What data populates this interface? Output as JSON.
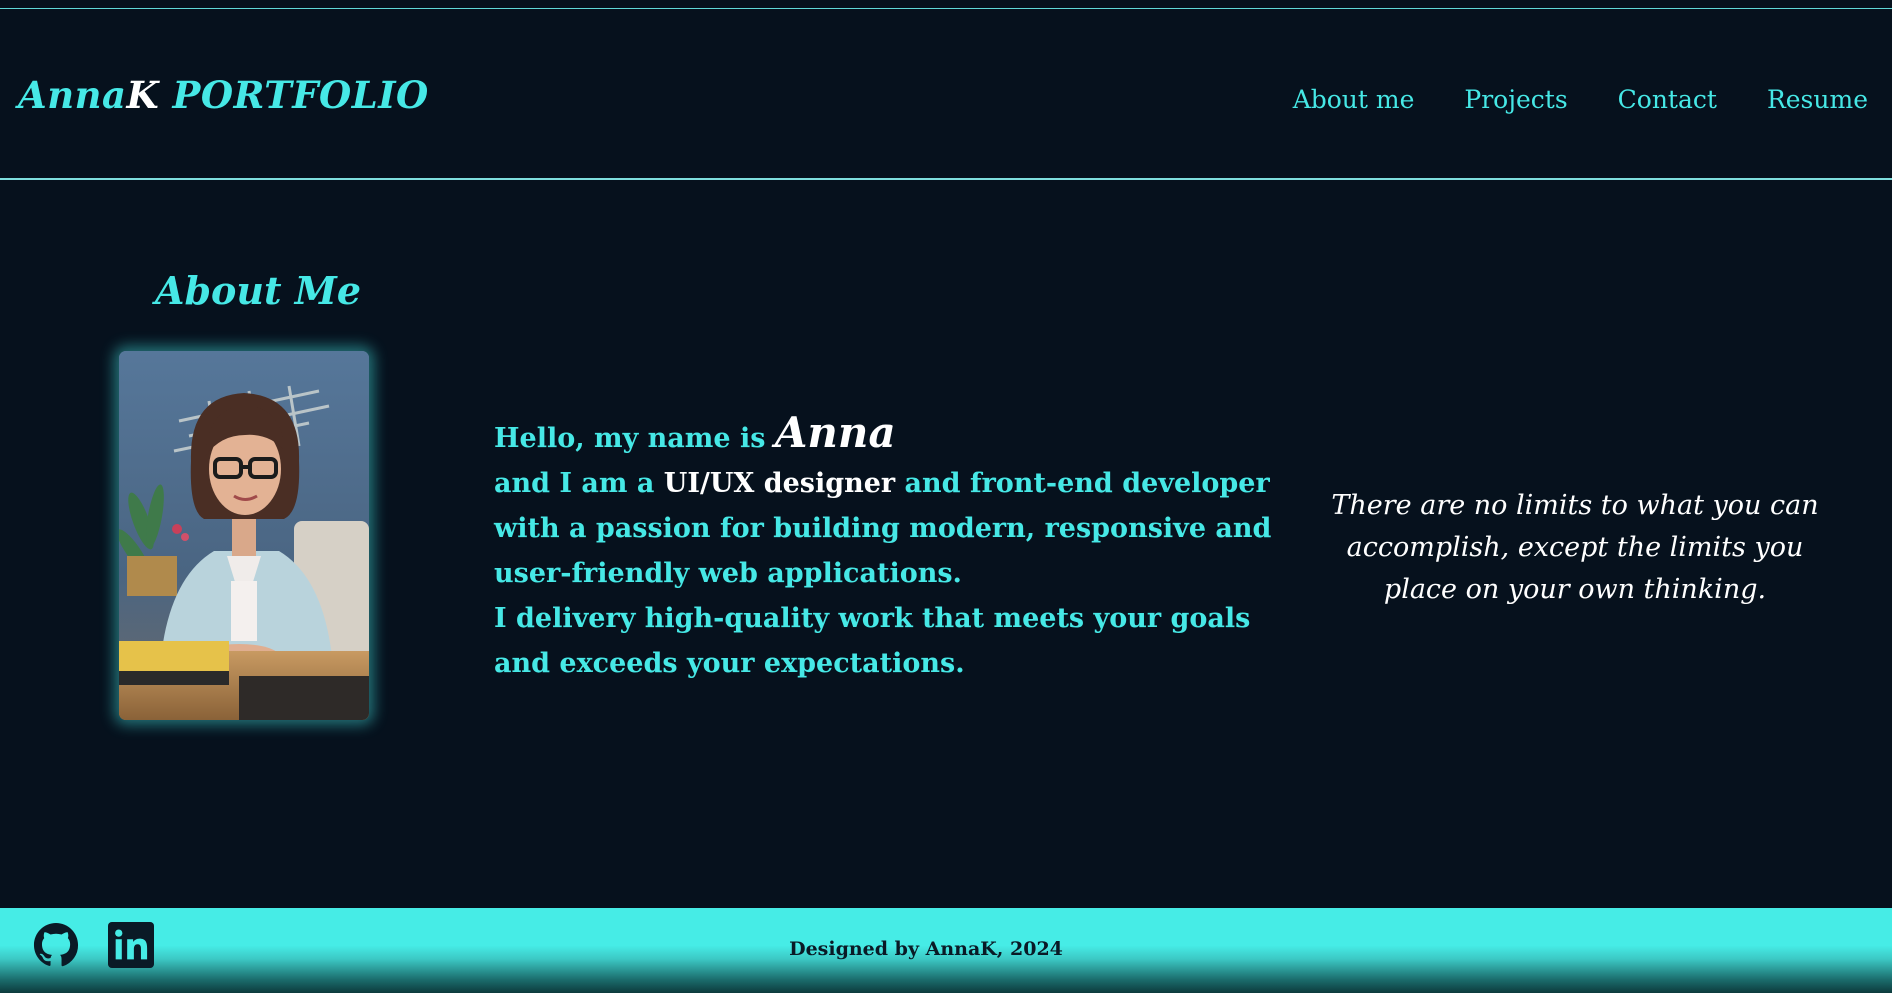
{
  "header": {
    "logo_part1": "Anna",
    "logo_part2": "K",
    "logo_part3": " PORTFOLIO",
    "nav": [
      "About me",
      "Projects",
      "Contact",
      "Resume"
    ]
  },
  "about": {
    "title": "About Me",
    "photo_icon": "profile-photo",
    "greeting": "Hello, my name is ",
    "name": "Anna",
    "line2_a": "and I am a ",
    "line2_b": "UI/UX designer",
    "line2_c": " and front-end developer with a passion for building modern, responsive and user-friendly web applications.",
    "line3": "I delivery high-quality work that meets your goals and exceeds your expectations.",
    "quote": "There are no limits to what you can accomplish, except the limits you place on your own thinking."
  },
  "footer": {
    "credit": "Designed by AnnaK, 2024",
    "icons": [
      "github-icon",
      "linkedin-icon"
    ]
  },
  "colors": {
    "background": "#06111d",
    "accent": "#46e8e6",
    "white": "#ffffff"
  }
}
